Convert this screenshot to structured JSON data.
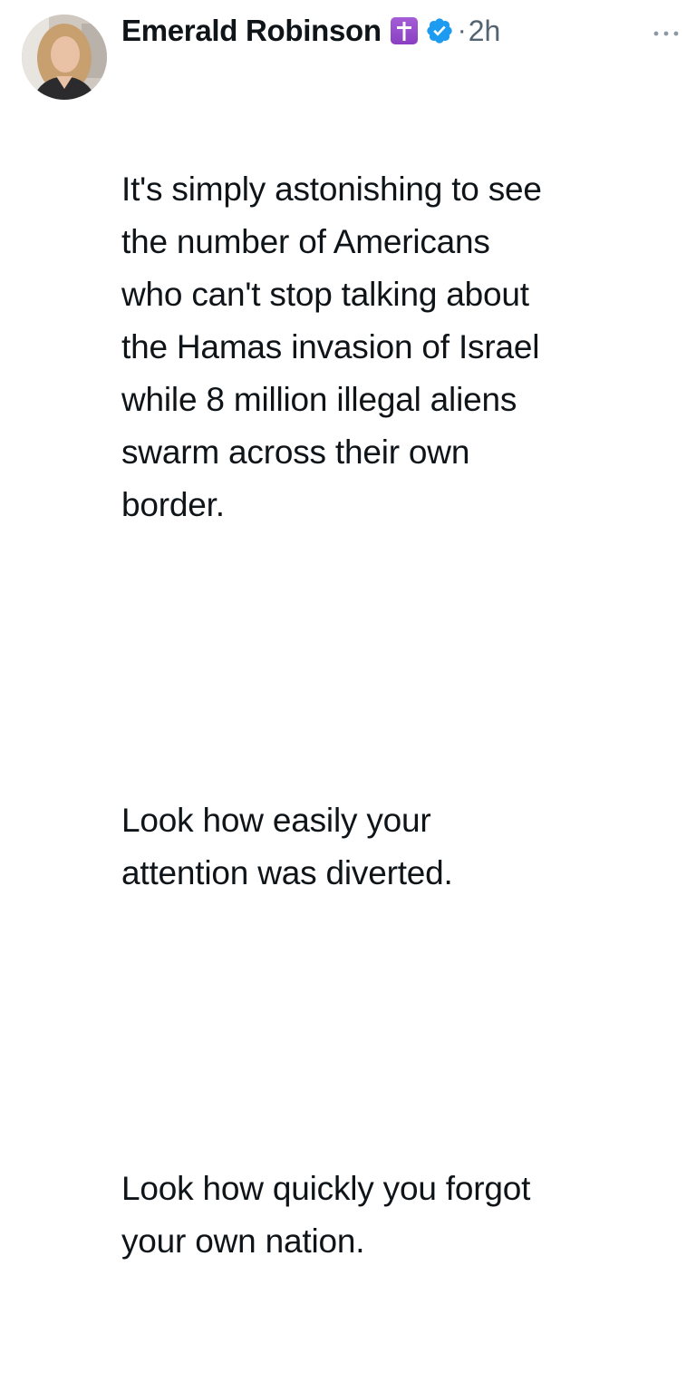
{
  "author": {
    "name": "Emerald Robinson",
    "badge_icon": "latin-cross-badge-icon",
    "verified_icon": "verified-checkmark-icon",
    "separator": "·",
    "time": "2h"
  },
  "tweet": {
    "paragraphs": [
      {
        "lines": [
          "It's simply astonishing to see",
          "the number of Americans",
          "who can't stop talking about",
          "the Hamas invasion of Israel",
          "while 8 million illegal aliens",
          "swarm across their own",
          "border."
        ]
      },
      {
        "lines": [
          "Look how easily your",
          "attention was diverted."
        ]
      },
      {
        "lines": [
          "Look how quickly you forgot",
          "your own nation."
        ]
      }
    ]
  },
  "colors": {
    "text": "#0f1419",
    "secondary": "#536471",
    "verified": "#1d9bf0",
    "badge": "#9b51d0"
  },
  "menu_icon": "more-horizontal-icon"
}
